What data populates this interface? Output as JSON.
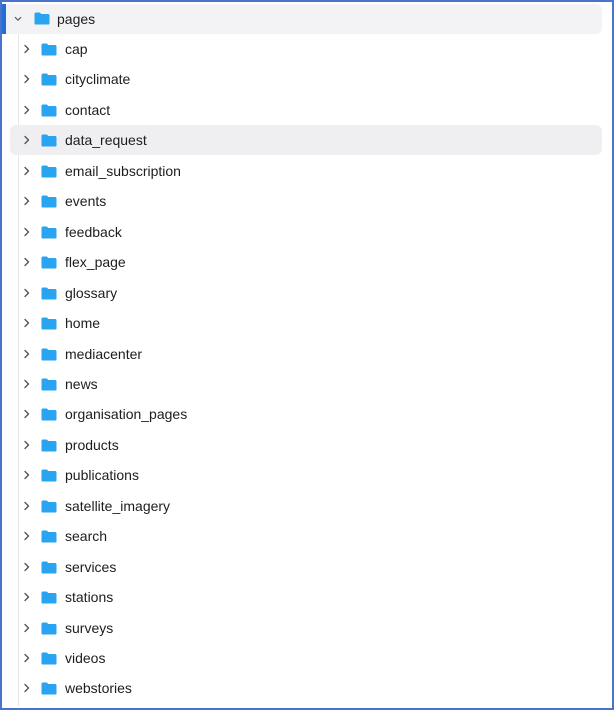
{
  "tree": {
    "root": {
      "label": "pages",
      "icon": "folder-icon",
      "expanded": true
    },
    "items": [
      {
        "label": "cap"
      },
      {
        "label": "cityclimate"
      },
      {
        "label": "contact"
      },
      {
        "label": "data_request"
      },
      {
        "label": "email_subscription"
      },
      {
        "label": "events"
      },
      {
        "label": "feedback"
      },
      {
        "label": "flex_page"
      },
      {
        "label": "glossary"
      },
      {
        "label": "home"
      },
      {
        "label": "mediacenter"
      },
      {
        "label": "news"
      },
      {
        "label": "organisation_pages"
      },
      {
        "label": "products"
      },
      {
        "label": "publications"
      },
      {
        "label": "satellite_imagery"
      },
      {
        "label": "search"
      },
      {
        "label": "services"
      },
      {
        "label": "stations"
      },
      {
        "label": "surveys"
      },
      {
        "label": "videos"
      },
      {
        "label": "webstories"
      }
    ],
    "selected_index": 3
  },
  "colors": {
    "folder": "#2aa3f0",
    "accent": "#1f6fd6",
    "selected_bg": "#efeff2",
    "frame_border": "#4a74c9"
  }
}
